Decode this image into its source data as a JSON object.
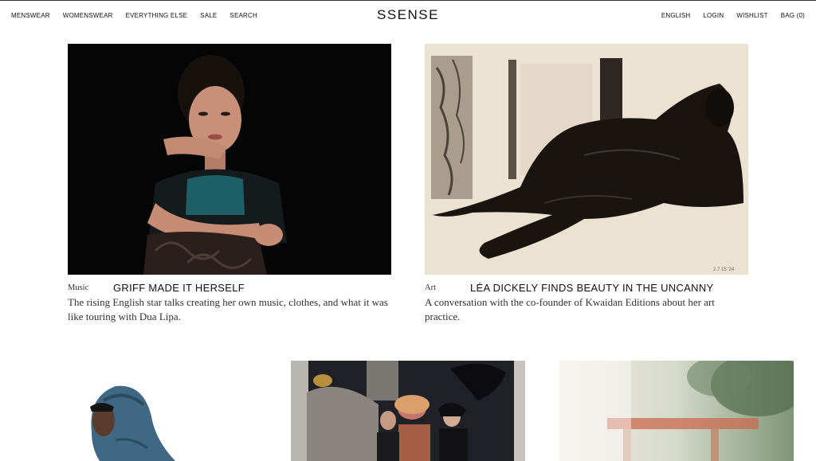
{
  "header": {
    "logo": "SSENSE",
    "nav_left": [
      "MENSWEAR",
      "WOMENSWEAR",
      "EVERYTHING ELSE",
      "SALE",
      "SEARCH"
    ],
    "nav_right": [
      "ENGLISH",
      "LOGIN",
      "WISHLIST",
      "BAG (0)"
    ]
  },
  "articles": [
    {
      "category": "Music",
      "title": "GRIFF MADE IT HERSELF",
      "description": "The rising English star talks creating her own music, clothes, and what it was like touring with Dua Lipa."
    },
    {
      "category": "Art",
      "title": "LÉA DICKELY FINDS BEAUTY IN THE UNCANNY",
      "description": "A conversation with the co-founder of Kwaidan Editions about her art practice."
    }
  ],
  "colors": {
    "text": "#111111",
    "background": "#ffffff"
  }
}
